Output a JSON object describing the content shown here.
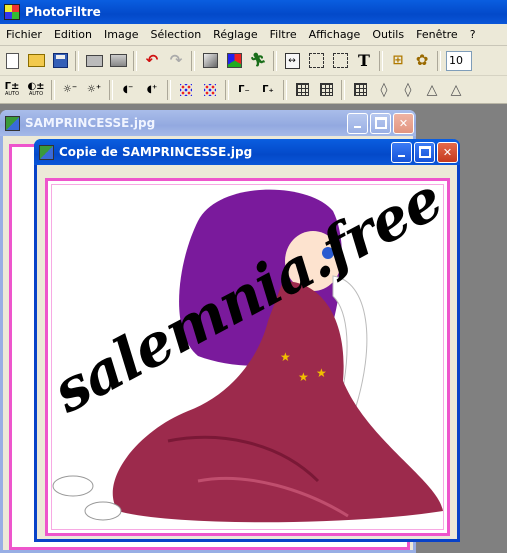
{
  "app": {
    "title": "PhotoFiltre"
  },
  "menu": [
    "Fichier",
    "Edition",
    "Image",
    "Sélection",
    "Réglage",
    "Filtre",
    "Affichage",
    "Outils",
    "Fenêtre",
    "?"
  ],
  "toolbar1": {
    "zoom_value": "10"
  },
  "toolbar2": {
    "auto_label": "AUTO"
  },
  "windows": {
    "back": {
      "title": "SAMPRINCESSE.jpg"
    },
    "front": {
      "title": "Copie de SAMPRINCESSE.jpg",
      "watermark": "salemnia.free.fr"
    }
  },
  "colors": {
    "title_active": "#0349c9",
    "title_inactive": "#98aee4",
    "canvas_border": "#ee55cc",
    "menu_bg": "#ece9d8"
  }
}
